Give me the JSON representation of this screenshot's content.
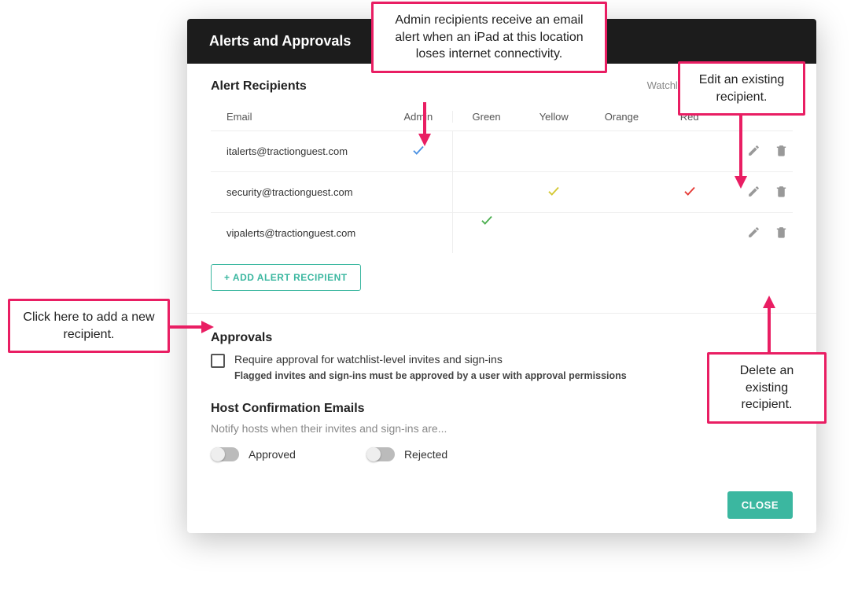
{
  "modal": {
    "title": "Alerts and Approvals",
    "alertRecipients": {
      "heading": "Alert Recipients",
      "watchlistLabel": "Watchlist Levels",
      "columns": {
        "email": "Email",
        "admin": "Admin",
        "green": "Green",
        "yellow": "Yellow",
        "orange": "Orange",
        "red": "Red"
      },
      "rows": [
        {
          "email": "italerts@tractionguest.com",
          "admin": true,
          "green": false,
          "yellow": false,
          "orange": false,
          "red": false
        },
        {
          "email": "security@tractionguest.com",
          "admin": false,
          "green": false,
          "yellow": true,
          "orange": false,
          "red": true
        },
        {
          "email": "vipalerts@tractionguest.com",
          "admin": false,
          "green": true,
          "yellow": false,
          "orange": false,
          "red": false
        }
      ],
      "addButton": "+ ADD ALERT RECIPIENT"
    },
    "approvals": {
      "heading": "Approvals",
      "requireLabel": "Require approval for watchlist-level invites and sign-ins",
      "requireSub": "Flagged invites and sign-ins must be approved by a user with approval permissions",
      "checked": false
    },
    "hostConfirmation": {
      "heading": "Host Confirmation Emails",
      "sub": "Notify hosts when their invites and sign-ins are...",
      "toggles": {
        "approved": {
          "label": "Approved",
          "on": false
        },
        "rejected": {
          "label": "Rejected",
          "on": false
        }
      }
    },
    "closeButton": "CLOSE"
  },
  "annotations": {
    "adminTip": "Admin recipients receive an email alert when an iPad at this location loses internet connectivity.",
    "editTip": "Edit an existing recipient.",
    "deleteTip": "Delete an existing recipient.",
    "addTip": "Click here to add a new recipient."
  }
}
